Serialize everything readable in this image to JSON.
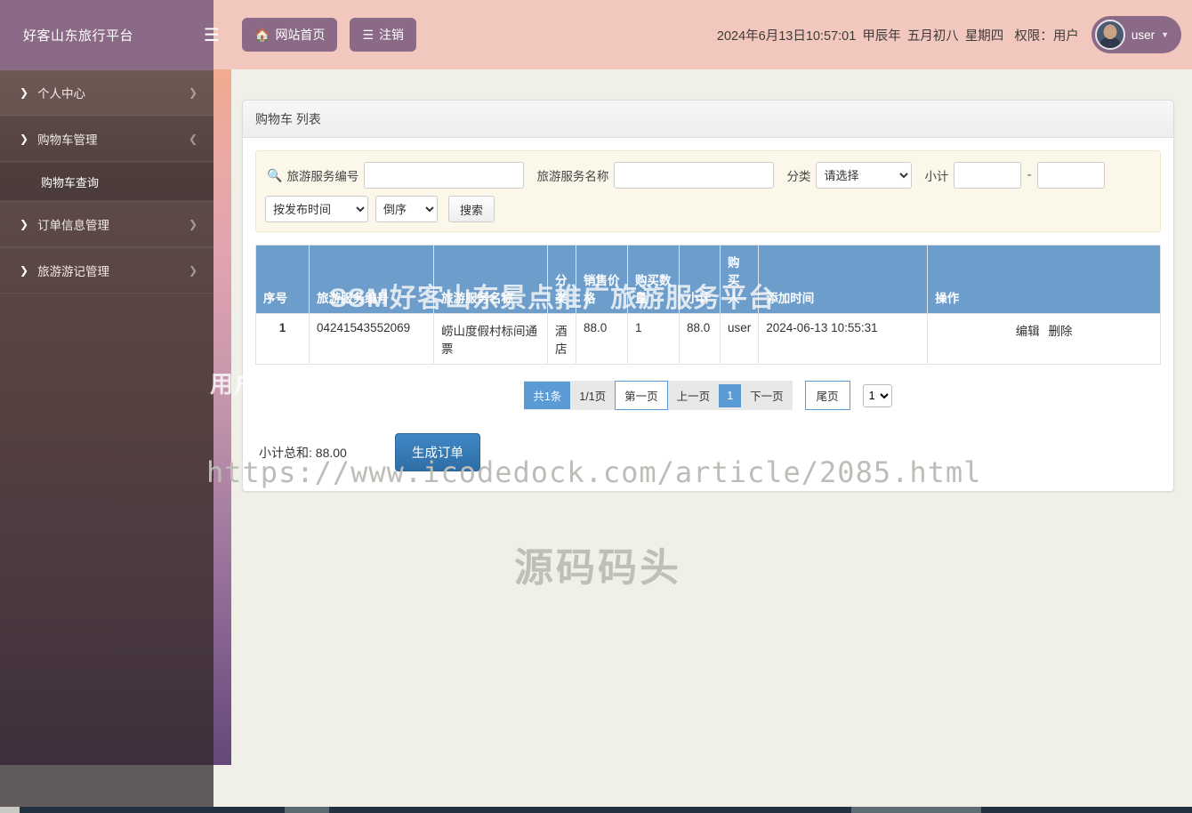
{
  "brand": {
    "title": "好客山东旅行平台"
  },
  "header": {
    "menu_toggle_icon": "hamburger-icon",
    "home_button": "网站首页",
    "home_icon": "home-icon",
    "logout_button": "注销",
    "logout_icon": "list-icon",
    "datetime": "2024年6月13日10:57:01",
    "lunar_year": "甲辰年",
    "lunar_date": "五月初八",
    "weekday": "星期四",
    "role_label": "权限：",
    "role_value": "用户",
    "user_name": "user",
    "caret_icon": "chevron-down-icon"
  },
  "sidebar": {
    "items": [
      {
        "label": "个人中心",
        "type": "parent",
        "chevron": "right"
      },
      {
        "label": "购物车管理",
        "type": "parent",
        "chevron": "down"
      },
      {
        "label": "购物车查询",
        "type": "child"
      },
      {
        "label": "订单信息管理",
        "type": "parent",
        "chevron": "right"
      },
      {
        "label": "旅游游记管理",
        "type": "parent",
        "chevron": "right"
      }
    ]
  },
  "panel": {
    "title": "购物车 列表"
  },
  "filters": {
    "search_icon": "search-icon",
    "code_label": "旅游服务编号",
    "code_value": "",
    "name_label": "旅游服务名称",
    "name_value": "",
    "category_label": "分类",
    "category_selected": "请选择",
    "category_options": [
      "请选择"
    ],
    "subtotal_label": "小计",
    "subtotal_min": "",
    "subtotal_max": "",
    "range_separator": "-",
    "sort_field_selected": "按发布时间",
    "sort_field_options": [
      "按发布时间"
    ],
    "sort_order_selected": "倒序",
    "sort_order_options": [
      "倒序"
    ],
    "search_button": "搜索"
  },
  "table": {
    "columns": [
      "序号",
      "旅游服务编号",
      "旅游服务名称",
      "分类",
      "销售价格",
      "购买数量",
      "小计",
      "购买人",
      "添加时间",
      "操作"
    ],
    "rows": [
      {
        "index": "1",
        "code": "04241543552069",
        "name": "崂山度假村标间通票",
        "category": "酒店",
        "price": "88.0",
        "quantity": "1",
        "subtotal": "88.0",
        "buyer": "user",
        "added_time": "2024-06-13 10:55:31",
        "edit": "编辑",
        "delete": "删除"
      }
    ]
  },
  "pagination": {
    "total_text": "共1条",
    "page_text": "1/1页",
    "first": "第一页",
    "prev": "上一页",
    "current_page": "1",
    "next": "下一页",
    "last": "尾页",
    "page_size_selected": "1",
    "page_size_options": [
      "1"
    ]
  },
  "footer": {
    "total_label": "小计总和: 88.00",
    "generate_order_button": "生成订单"
  },
  "watermarks": {
    "title": "SSM好客山东景点推广旅游服务平台",
    "subtitle": "用户角色-购物车管理功能",
    "url": "https://www.icodedock.com/article/2085.html",
    "site": "源码码头"
  },
  "colors": {
    "brand_purple": "#8b6a87",
    "header_pink": "#f2c7bd",
    "table_header_blue": "#6d9dcb",
    "primary_button_blue": "#3f87c4",
    "filter_bg": "#fbf8e9"
  }
}
